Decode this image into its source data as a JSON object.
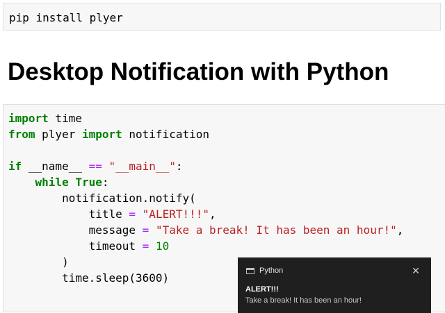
{
  "install_cell": {
    "code": "pip install plyer"
  },
  "heading": "Desktop Notification with Python",
  "code_cell": {
    "line1": {
      "kw": "import",
      "rest": " time"
    },
    "line2": {
      "kw1": "from",
      "mid": " plyer ",
      "kw2": "import",
      "rest": " notification"
    },
    "line4": {
      "kw": "if",
      "a": " __name__ ",
      "op": "==",
      "b": " ",
      "str": "\"__main__\"",
      "c": ":"
    },
    "line5": {
      "indent": "    ",
      "kw1": "while",
      "sp": " ",
      "kw2": "True",
      "c": ":"
    },
    "line6": {
      "text": "        notification.notify("
    },
    "line7": {
      "pre": "            title ",
      "op": "=",
      "sp": " ",
      "str": "\"ALERT!!!\"",
      "post": ","
    },
    "line8": {
      "pre": "            message ",
      "op": "=",
      "sp": " ",
      "str": "\"Take a break! It has been an hour!\"",
      "post": ","
    },
    "line9": {
      "pre": "            timeout ",
      "op": "=",
      "sp": " ",
      "num": "10"
    },
    "line10": {
      "text": "        )"
    },
    "line11": {
      "text": "        time.sleep(3600)"
    }
  },
  "toast": {
    "app_name": "Python",
    "close_glyph": "✕",
    "title": "ALERT!!!",
    "message": "Take a break! It has been an hour!"
  }
}
